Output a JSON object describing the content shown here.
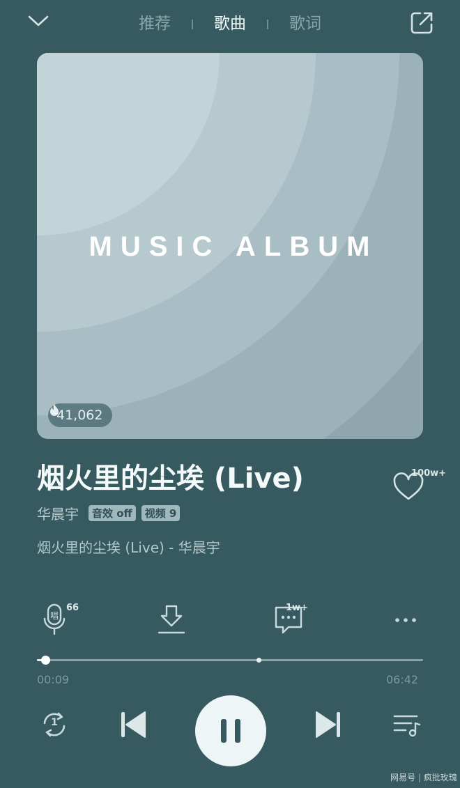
{
  "nav": {
    "tabs": [
      "推荐",
      "歌曲",
      "歌词"
    ],
    "active_tab": "歌曲"
  },
  "album": {
    "cover_text": "MUSIC ALBUM",
    "heat_count": "41,062"
  },
  "song": {
    "title": "烟火里的尘埃 (Live)",
    "artist": "华晨宇",
    "tags": [
      "音效 off",
      "视频 9"
    ],
    "subtitle": "烟火里的尘埃 (Live) - 华晨宇",
    "like_count": "100w+"
  },
  "actions": {
    "sing_count": "66",
    "comment_count": "1w+"
  },
  "progress": {
    "current_time": "00:09",
    "total_time": "06:42",
    "fraction": 0.022
  },
  "playback": {
    "loop_badge": "1"
  },
  "watermark": {
    "source": "网易号",
    "author": "疯批玫瑰"
  },
  "colors": {
    "background": "#365a60",
    "album": "#8fa8b0",
    "accent": "#edf5f6"
  }
}
